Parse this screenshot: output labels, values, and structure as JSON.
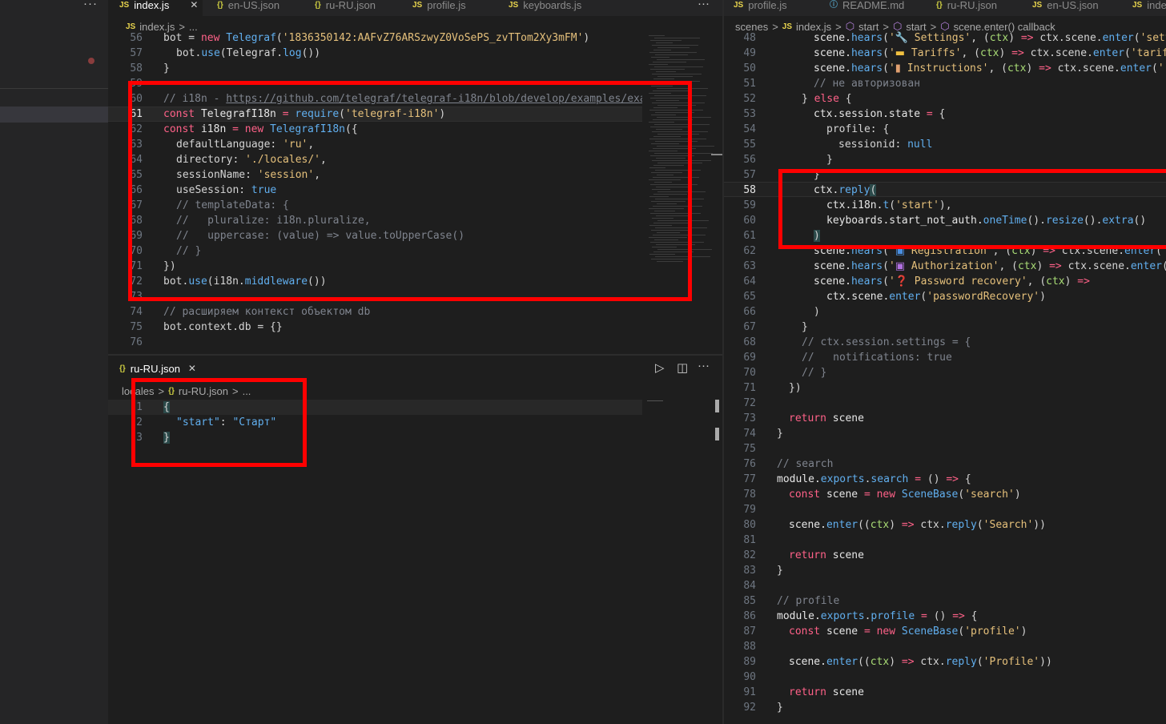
{
  "sidebar": {
    "more": "···"
  },
  "left_tabs": [
    {
      "icon": "JS",
      "label": "index.js",
      "close": "✕",
      "active": true
    },
    {
      "icon": "{}",
      "label": "en-US.json"
    },
    {
      "icon": "{}",
      "label": "ru-RU.json"
    },
    {
      "icon": "JS",
      "label": "profile.js"
    },
    {
      "icon": "JS",
      "label": "keyboards.js"
    }
  ],
  "left_more": "···",
  "right_tabs": [
    {
      "icon": "JS",
      "label": "profile.js"
    },
    {
      "icon": "ⓘ",
      "label": "README.md"
    },
    {
      "icon": "{}",
      "label": "ru-RU.json"
    },
    {
      "icon": "JS",
      "label": "en-US.json"
    },
    {
      "icon": "JS",
      "label": "inde"
    }
  ],
  "left_breadcrumb": {
    "icon": "JS",
    "file": "index.js",
    "sep": ">",
    "rest": "..."
  },
  "right_breadcrumb": {
    "folder": "scenes",
    "sep": ">",
    "icon": "JS",
    "file": "index.js",
    "sym1": "start",
    "sym2": "start",
    "sym3": "scene.enter() callback"
  },
  "left_code": {
    "lines": [
      "56",
      "57",
      "58",
      "59",
      "60",
      "61",
      "62",
      "63",
      "64",
      "65",
      "66",
      "67",
      "68",
      "69",
      "70",
      "71",
      "72",
      "73",
      "74",
      "75",
      "76"
    ],
    "current": "61"
  },
  "bottom_panel": {
    "tab_label": "ru-RU.json",
    "tab_icon": "{}",
    "close": "✕",
    "more": "···",
    "breadcrumb": {
      "folder": "locales",
      "sep": ">",
      "icon": "{}",
      "file": "ru-RU.json",
      "rest": "..."
    },
    "lines": [
      "1",
      "2",
      "3"
    ],
    "json_key": "\"start\"",
    "json_value": "\"Старт\""
  },
  "right_code": {
    "lines": [
      "48",
      "49",
      "50",
      "51",
      "52",
      "53",
      "54",
      "55",
      "56",
      "57",
      "58",
      "59",
      "60",
      "61",
      "62",
      "63",
      "64",
      "65",
      "66",
      "67",
      "68",
      "69",
      "70",
      "71",
      "72",
      "73",
      "74",
      "75",
      "76",
      "77",
      "78",
      "79",
      "80",
      "81",
      "82",
      "83",
      "84",
      "85",
      "86",
      "87",
      "88",
      "89",
      "90",
      "91",
      "92"
    ],
    "current": "58"
  },
  "colors": {
    "highlight_border": "#ff0000",
    "editor_bg": "#1e1e1e",
    "sidebar_bg": "#252526"
  }
}
